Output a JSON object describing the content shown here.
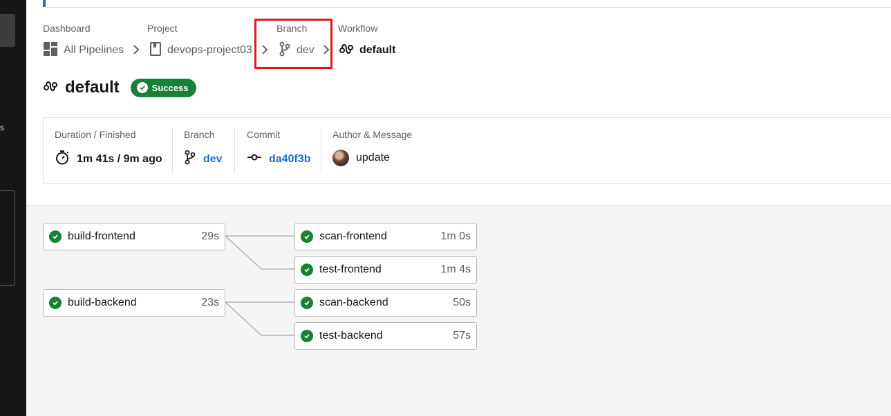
{
  "breadcrumb": {
    "dashboard": {
      "label": "Dashboard",
      "value": "All Pipelines"
    },
    "project": {
      "label": "Project",
      "value": "devops-project03"
    },
    "branch": {
      "label": "Branch",
      "value": "dev"
    },
    "workflow": {
      "label": "Workflow",
      "value": "default"
    }
  },
  "workflow": {
    "title": "default",
    "status": "Success",
    "status_color": "#198038"
  },
  "info": {
    "duration": {
      "label": "Duration / Finished",
      "value": "1m 41s / 9m ago"
    },
    "branch": {
      "label": "Branch",
      "value": "dev"
    },
    "commit": {
      "label": "Commit",
      "value": "da40f3b"
    },
    "author": {
      "label": "Author & Message",
      "message": "update"
    }
  },
  "jobs": [
    {
      "name": "build-frontend",
      "duration": "29s",
      "status": "success"
    },
    {
      "name": "scan-frontend",
      "duration": "1m 0s",
      "status": "success"
    },
    {
      "name": "test-frontend",
      "duration": "1m 4s",
      "status": "success"
    },
    {
      "name": "build-backend",
      "duration": "23s",
      "status": "success"
    },
    {
      "name": "scan-backend",
      "duration": "50s",
      "status": "success"
    },
    {
      "name": "test-backend",
      "duration": "57s",
      "status": "success"
    }
  ],
  "colors": {
    "accent": "#1a6fc4",
    "success": "#198038",
    "highlight": "#e8141c"
  }
}
